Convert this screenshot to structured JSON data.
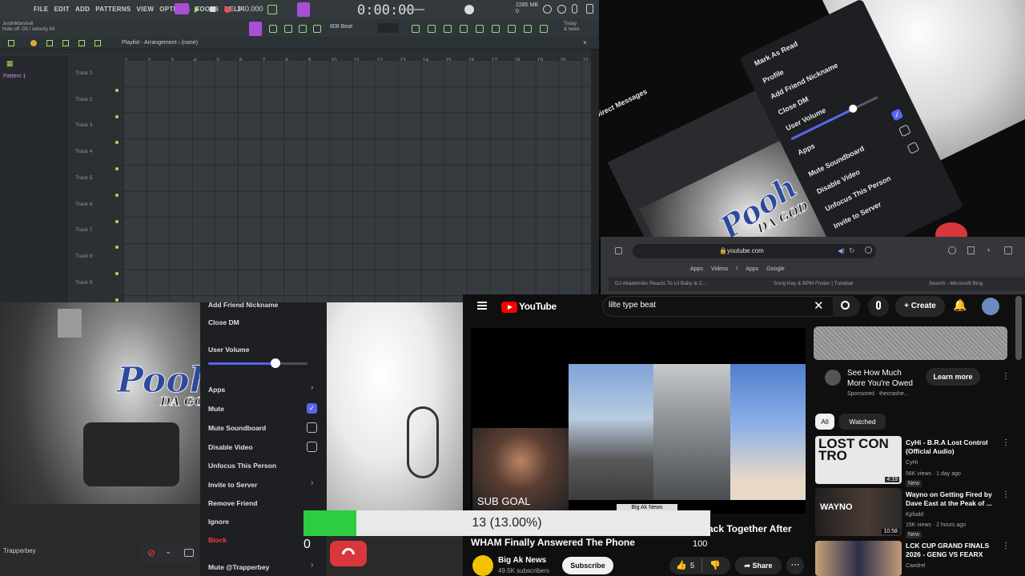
{
  "fl_studio": {
    "menu": [
      "FILE",
      "EDIT",
      "ADD",
      "PATTERNS",
      "VIEW",
      "OPTIONS",
      "TOOLS",
      "HELP"
    ],
    "tempo": "140.000",
    "time": "0:00:00",
    "cpu": [
      "2285 MB",
      "0"
    ],
    "hint_line1": "JustinMarshall",
    "hint_line2": "Note off: D5 / velocity 64",
    "preset": "808 Beat",
    "today_line1": "Today",
    "today_line2": "& news",
    "playlist_title": "Playlist - Arrangement › (none)",
    "pattern": "Pattern 1",
    "tracks": [
      "Track 1",
      "Track 2",
      "Track 3",
      "Track 4",
      "Track 5",
      "Track 6",
      "Track 7",
      "Track 8",
      "Track 9"
    ],
    "ruler": [
      "1",
      "2",
      "3",
      "4",
      "5",
      "6",
      "7",
      "8",
      "9",
      "10",
      "11",
      "12",
      "13",
      "14",
      "15",
      "16",
      "17",
      "18",
      "19",
      "20",
      "21"
    ]
  },
  "discord_tilted": {
    "title": "Direct Messages",
    "items": [
      "Mark As Read",
      "Profile",
      "Add Friend Nickname",
      "Close DM",
      "User Volume",
      "Apps",
      "Mute Soundboard",
      "Disable Video",
      "Unfocus This Person",
      "Invite to Server"
    ],
    "volume": 0.72
  },
  "browser": {
    "url": "youtube.com",
    "bookmarks": [
      "Apps",
      "Videos",
      "/",
      "Apps",
      "Google"
    ],
    "tabs": [
      "DJ Akademiks Reacts To Lil Baby & C...",
      "Song Key & BPM Finder | Tunebat",
      "Search - Microsoft Bing"
    ]
  },
  "discord_menu": {
    "items": [
      {
        "label": "Add Friend Nickname",
        "chevron": false
      },
      {
        "label": "Close DM",
        "chevron": false
      },
      {
        "label": "User Volume",
        "chevron": false
      },
      {
        "label": "Apps",
        "chevron": true
      },
      {
        "label": "Mute",
        "chevron": false
      },
      {
        "label": "Mute Soundboard",
        "chevron": false
      },
      {
        "label": "Disable Video",
        "chevron": false
      },
      {
        "label": "Unfocus This Person",
        "chevron": false
      },
      {
        "label": "Invite to Server",
        "chevron": true
      },
      {
        "label": "Remove Friend",
        "chevron": false
      },
      {
        "label": "Ignore",
        "chevron": true
      },
      {
        "label": "Block",
        "chevron": false
      },
      {
        "label": "Mute @Trapperbey",
        "chevron": true
      }
    ],
    "volume": 0.68,
    "user": "Trapperbey",
    "block_color": "#f23f42"
  },
  "logo": {
    "text_main": "Pooh",
    "text_sub": "DA GOD"
  },
  "youtube": {
    "logo": "YouTube",
    "search_query": "lilte type beat",
    "create_label": "Create",
    "sub_goal": "SUB GOAL",
    "caption_box": "Big Ak News",
    "title_tail": "ack Together After",
    "title": "WHAM Finally Answered The Phone",
    "count": "100",
    "channel": "Big Ak News",
    "subscribers": "49.5K subscribers",
    "subscribe_label": "Subscribe",
    "likes": "5",
    "share_label": "Share",
    "ad": {
      "title": "See How Much More You're Owed",
      "meta": "Sponsored · thecrashe...",
      "cta": "Learn more"
    },
    "chips": [
      "All",
      "Watched"
    ],
    "recommendations": [
      {
        "title": "CyHi - B.R.A Lost Control (Official Audio)",
        "channel": "CyHi",
        "meta": "56K views · 1 day ago",
        "badge": "New",
        "duration": "4:19",
        "thumb_text": "LOST CON TRO"
      },
      {
        "title": "Wayno on Getting Fired by Dave East at the Peak of ...",
        "channel": "Kpfudd",
        "meta": "15K views · 2 hours ago",
        "badge": "New",
        "duration": "10:58",
        "thumb_text": "WAYNO"
      },
      {
        "title": "LCK CUP GRAND FINALS 2026 - GENG VS FEARX",
        "channel": "Caedrel",
        "meta": "",
        "badge": "",
        "duration": "",
        "thumb_text": ""
      }
    ]
  },
  "progress": {
    "label": "13 (13.00%)",
    "value": 0.13,
    "min_label": "0",
    "fill_color": "#2ecc40"
  }
}
